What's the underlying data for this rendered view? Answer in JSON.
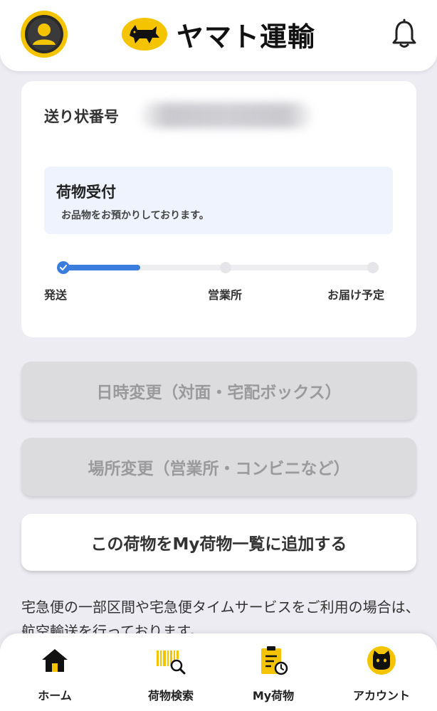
{
  "header": {
    "brand": "ヤマト運輸",
    "icons": {
      "avatar": "user-avatar-icon",
      "logo": "black-cat-logo-icon",
      "bell": "bell-icon"
    },
    "accent_color": "#f5c400"
  },
  "tracking": {
    "label": "送り状番号",
    "status_title": "荷物受付",
    "status_description": "お品物をお預かりしております。",
    "progress_percent": 25,
    "steps": [
      {
        "label": "発送",
        "done": true
      },
      {
        "label": "営業所",
        "done": false
      },
      {
        "label": "お届け予定",
        "done": false
      }
    ],
    "progress_color": "#3b7ddd"
  },
  "actions": {
    "change_datetime": "日時変更（対面・宅配ボックス）",
    "change_location": "場所変更（営業所・コンビニなど）",
    "add_to_my_list": "この荷物をMy荷物一覧に追加する"
  },
  "note": "宅急便の一部区間や宅急便タイムサービスをご利用の場合は、航空輸送を行っております。",
  "bottom_nav": {
    "items": [
      {
        "label": "ホーム",
        "icon": "home-icon"
      },
      {
        "label": "荷物検索",
        "icon": "barcode-search-icon"
      },
      {
        "label": "My荷物",
        "icon": "clipboard-clock-icon"
      },
      {
        "label": "アカウント",
        "icon": "cat-account-icon"
      }
    ]
  }
}
